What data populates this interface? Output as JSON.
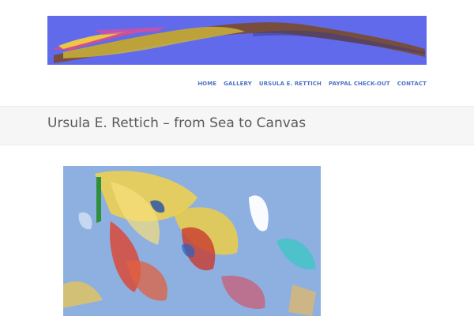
{
  "site": {
    "nav": {
      "items": [
        {
          "label": "HOME"
        },
        {
          "label": "GALLERY"
        },
        {
          "label": "URSULA E. RETTICH"
        },
        {
          "label": "PAYPAL CHECK-OUT"
        },
        {
          "label": "CONTACT"
        }
      ]
    }
  },
  "page": {
    "title": "Ursula E. Rettich – from Sea to Canvas"
  },
  "colors": {
    "nav_link": "#4f73c7",
    "banner_background": "#5a63e8",
    "title_band": "#f6f6f6",
    "title_text": "#5a5a5a"
  }
}
